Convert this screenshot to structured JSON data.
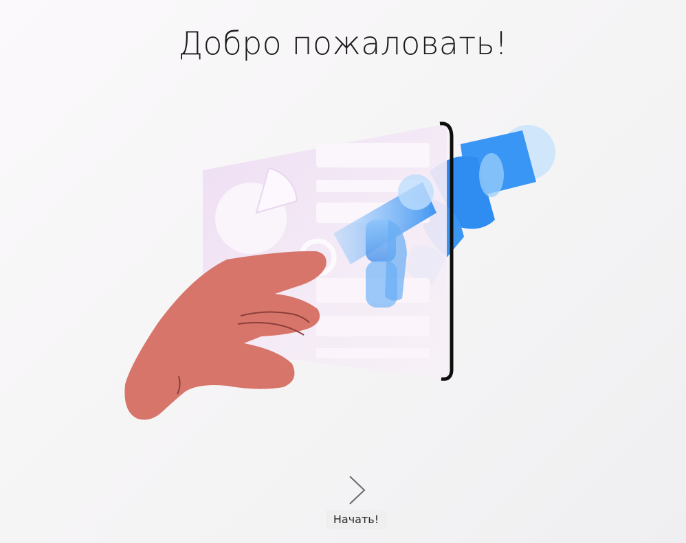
{
  "welcome": {
    "title": "Добро пожаловать!"
  },
  "hero": {
    "icon": "hand-and-robot-hand-illustration"
  },
  "start": {
    "label": "Начать!",
    "icon": "chevron-right-icon"
  },
  "colors": {
    "hand": "#d8756a",
    "robot_blue": "#3f95f2",
    "panel": "#f1e6f5",
    "title_text": "#1b1b1b"
  }
}
